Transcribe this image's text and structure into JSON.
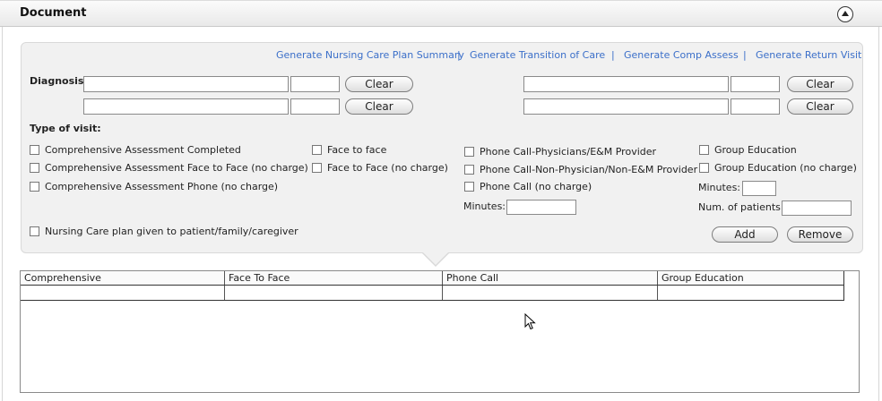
{
  "header": {
    "title": "Document"
  },
  "links": [
    "Generate Nursing Care Plan Summary",
    "Generate Transition of Care",
    "Generate Comp Assess",
    "Generate Return Visit"
  ],
  "link_separator": "|",
  "diagnosis": {
    "label": "Diagnosis:",
    "clear_label": "Clear",
    "rows": [
      {
        "left_text": "",
        "left_code": "",
        "right_text": "",
        "right_code": ""
      },
      {
        "left_text": "",
        "left_code": "",
        "right_text": "",
        "right_code": ""
      }
    ]
  },
  "visit": {
    "label": "Type of visit:",
    "comprehensive": [
      "Comprehensive Assessment Completed",
      "Comprehensive Assessment Face to Face (no charge)",
      "Comprehensive Assessment Phone (no charge)"
    ],
    "face": [
      "Face to face",
      "Face to Face (no charge)"
    ],
    "phone": [
      "Phone Call-Physicians/E&M Provider",
      "Phone Call-Non-Physician/Non-E&M Provider",
      "Phone Call (no charge)"
    ],
    "phone_minutes_label": "Minutes:",
    "phone_minutes_value": "",
    "group": [
      "Group Education",
      "Group Education (no charge)"
    ],
    "group_minutes_label": "Minutes:",
    "group_minutes_value": "",
    "patients_label": "Num. of patients:",
    "patients_value": "",
    "nursing_care": "Nursing Care plan given to patient/family/caregiver"
  },
  "actions": {
    "add": "Add",
    "remove": "Remove"
  },
  "table": {
    "columns": [
      "Comprehensive",
      "Face To Face",
      "Phone Call",
      "Group Education"
    ],
    "rows": [
      [
        "",
        "",
        "",
        ""
      ]
    ]
  }
}
